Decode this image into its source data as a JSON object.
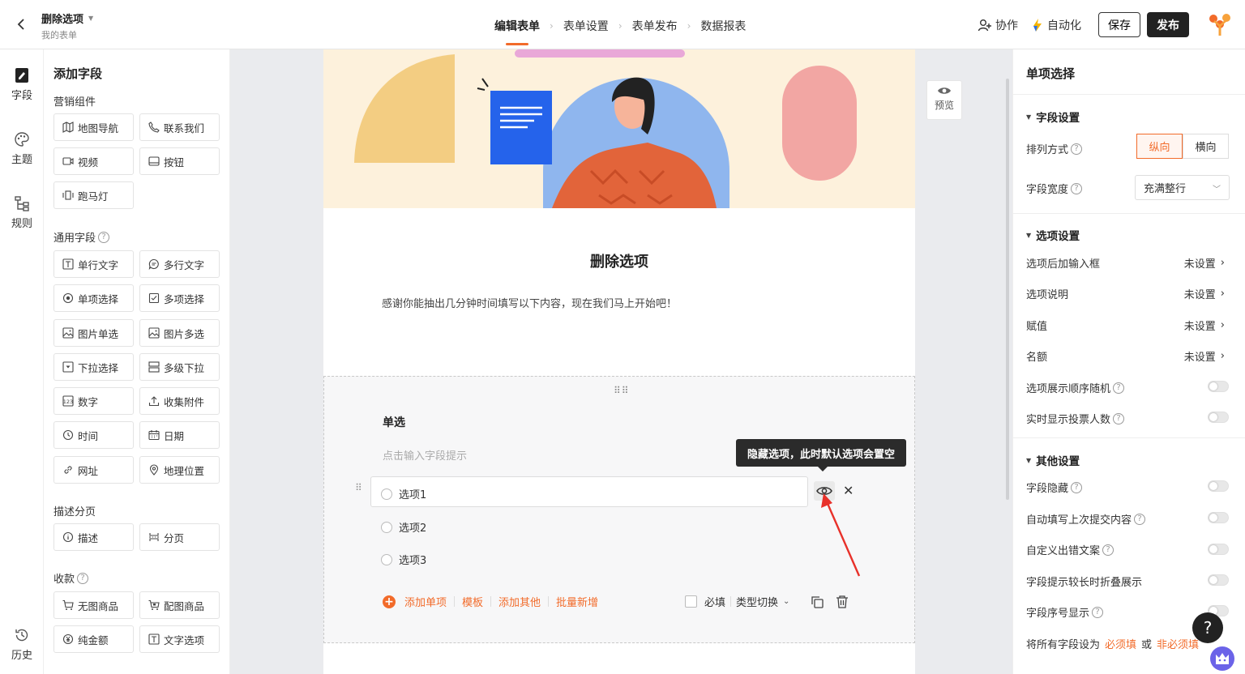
{
  "header": {
    "form_name": "删除选项",
    "parent": "我的表单",
    "steps": [
      "编辑表单",
      "表单设置",
      "表单发布",
      "数据报表"
    ],
    "collab": "协作",
    "automation": "自动化",
    "save": "保存",
    "publish": "发布"
  },
  "leftnav": {
    "fields": "字段",
    "theme": "主题",
    "rules": "规则",
    "history": "历史"
  },
  "fieldpanel": {
    "title": "添加字段",
    "sec_marketing": "营销组件",
    "marketing": [
      "地图导航",
      "联系我们",
      "视频",
      "按钮",
      "跑马灯"
    ],
    "sec_common": "通用字段",
    "common": [
      "单行文字",
      "多行文字",
      "单项选择",
      "多项选择",
      "图片单选",
      "图片多选",
      "下拉选择",
      "多级下拉",
      "数字",
      "收集附件",
      "时间",
      "日期",
      "网址",
      "地理位置"
    ],
    "sec_desc": "描述分页",
    "desc": [
      "描述",
      "分页"
    ],
    "sec_pay": "收款",
    "pay": [
      "无图商品",
      "配图商品",
      "纯金额",
      "文字选项"
    ]
  },
  "form": {
    "title": "删除选项",
    "description": "感谢你能抽出几分钟时间填写以下内容，现在我们马上开始吧！",
    "field_label": "单选",
    "field_hint": "点击输入字段提示",
    "options": [
      "选项1",
      "选项2",
      "选项3"
    ],
    "tooltip": "隐藏选项，此时默认选项会置空",
    "actions": [
      "添加单项",
      "模板",
      "添加其他",
      "批量新增"
    ],
    "required": "必填",
    "type_switch": "类型切换"
  },
  "preview": "预览",
  "rightpanel": {
    "title": "单项选择",
    "sec_field": "字段设置",
    "layout_label": "排列方式",
    "layout_vertical": "纵向",
    "layout_horizontal": "横向",
    "width_label": "字段宽度",
    "width_value": "充满整行",
    "sec_option": "选项设置",
    "option_rows": [
      {
        "label": "选项后加输入框",
        "value": "未设置"
      },
      {
        "label": "选项说明",
        "value": "未设置"
      },
      {
        "label": "赋值",
        "value": "未设置"
      },
      {
        "label": "名额",
        "value": "未设置"
      }
    ],
    "random_order": "选项展示顺序随机",
    "show_votes": "实时显示投票人数",
    "sec_other": "其他设置",
    "hide_field": "字段隐藏",
    "autofill": "自动填写上次提交内容",
    "custom_error": "自定义出错文案",
    "fold_hint": "字段提示较长时折叠展示",
    "show_index": "字段序号显示",
    "all_fields_prefix": "将所有字段设为",
    "all_required": "必须填",
    "or": "或",
    "all_optional": "非必须填"
  },
  "help": "?",
  "colors": {
    "accent": "#f26b2a",
    "dark": "#222222"
  }
}
